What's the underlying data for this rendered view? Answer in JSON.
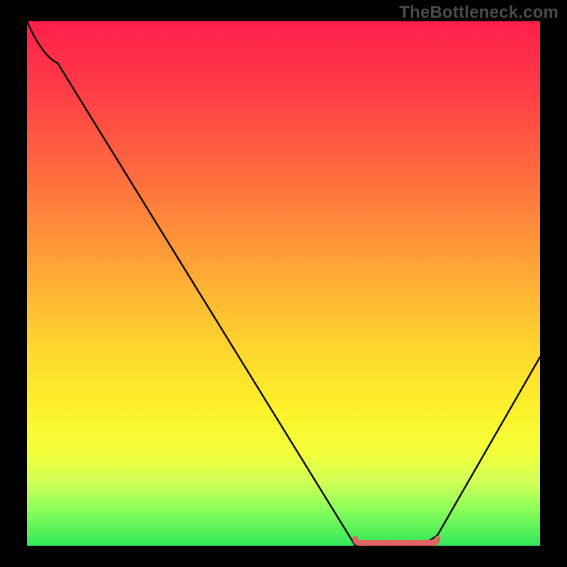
{
  "watermark": "TheBottleneck.com",
  "chart_data": {
    "type": "line",
    "title": "",
    "xlabel": "",
    "ylabel": "",
    "xlim": [
      0,
      100
    ],
    "ylim": [
      0,
      100
    ],
    "grid": false,
    "series": [
      {
        "name": "curve",
        "x": [
          0,
          6,
          64,
          67,
          77,
          80,
          100
        ],
        "values": [
          100,
          92,
          0,
          0,
          0,
          2,
          36
        ]
      }
    ],
    "flat_segment": {
      "x_start": 64,
      "x_end": 80,
      "y": 0,
      "color": "#e06666",
      "stroke_width": 8
    },
    "background_gradient": {
      "direction": "top-to-bottom",
      "stops": [
        {
          "pos": 0,
          "color": "#ff1f4a"
        },
        {
          "pos": 12,
          "color": "#ff3a46"
        },
        {
          "pos": 30,
          "color": "#ff6e3e"
        },
        {
          "pos": 48,
          "color": "#ffa936"
        },
        {
          "pos": 62,
          "color": "#ffd52e"
        },
        {
          "pos": 74,
          "color": "#fcf12a"
        },
        {
          "pos": 82,
          "color": "#f4ff3a"
        },
        {
          "pos": 88,
          "color": "#cfff56"
        },
        {
          "pos": 93,
          "color": "#8bff5a"
        },
        {
          "pos": 100,
          "color": "#32e85a"
        }
      ]
    }
  }
}
